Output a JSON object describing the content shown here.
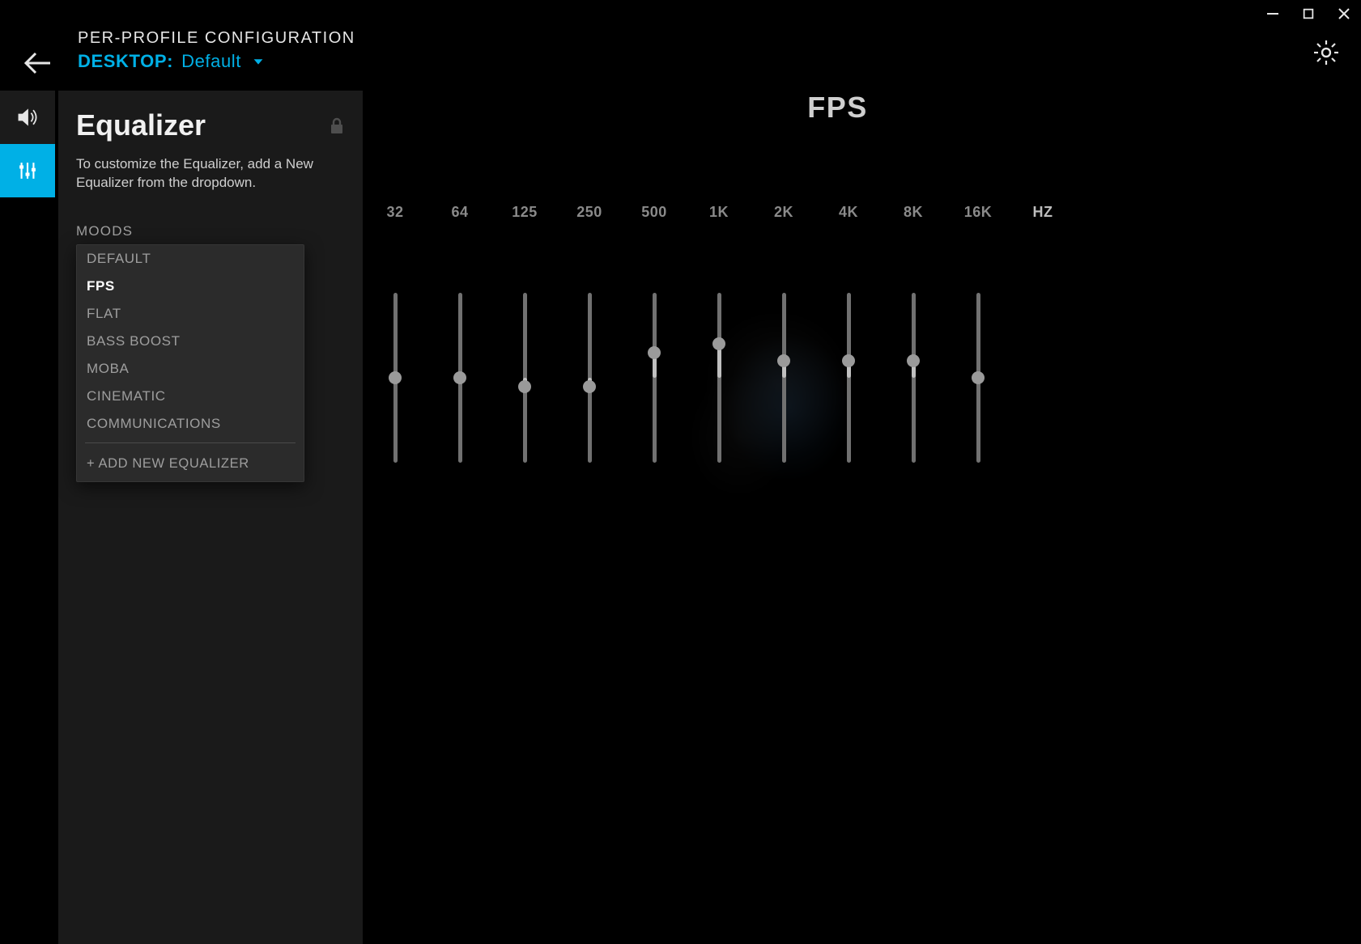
{
  "window_controls": {
    "minimize": "minimize",
    "maximize": "maximize",
    "close": "close"
  },
  "header": {
    "title": "PER-PROFILE CONFIGURATION",
    "profile_label": "DESKTOP:",
    "profile_value": "Default"
  },
  "rail": {
    "items": [
      {
        "name": "acoustics",
        "icon": "speaker-icon",
        "active": false
      },
      {
        "name": "equalizer",
        "icon": "sliders-icon",
        "active": true
      }
    ]
  },
  "side": {
    "title": "Equalizer",
    "description": "To customize the Equalizer, add a New Equalizer from the dropdown.",
    "moods_label": "MOODS",
    "moods": [
      {
        "label": "DEFAULT",
        "selected": false
      },
      {
        "label": "FPS",
        "selected": true
      },
      {
        "label": "FLAT",
        "selected": false
      },
      {
        "label": "BASS BOOST",
        "selected": false
      },
      {
        "label": "MOBA",
        "selected": false
      },
      {
        "label": "CINEMATIC",
        "selected": false
      },
      {
        "label": "COMMUNICATIONS",
        "selected": false
      }
    ],
    "add_new": "+ ADD NEW EQUALIZER",
    "locked": true
  },
  "equalizer": {
    "preset_title": "FPS",
    "bands": [
      "32",
      "64",
      "125",
      "250",
      "500",
      "1K",
      "2K",
      "4K",
      "8K",
      "16K"
    ],
    "unit_label": "HZ",
    "values_db": [
      0,
      0,
      -1,
      -1,
      3,
      4,
      2,
      2,
      2,
      0
    ],
    "range_db": [
      -10,
      10
    ]
  },
  "colors": {
    "accent": "#00b0e6"
  }
}
